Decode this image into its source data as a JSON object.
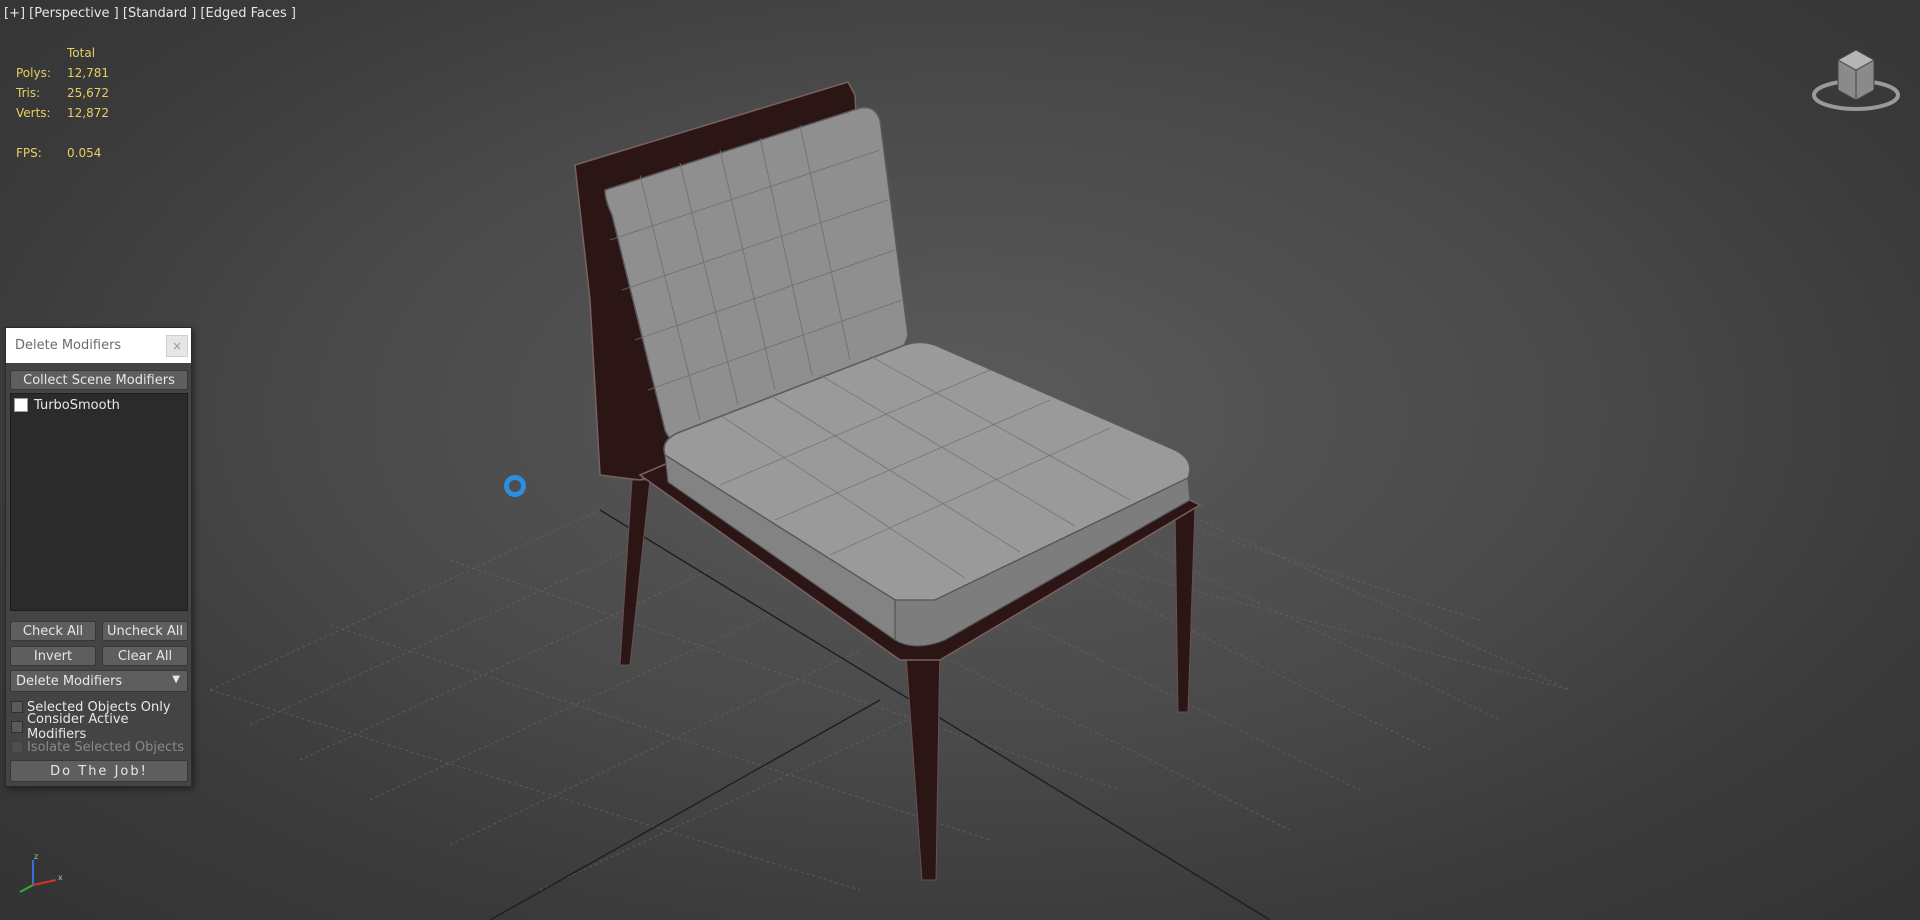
{
  "viewport": {
    "label": "[+] [Perspective ] [Standard ] [Edged Faces ]"
  },
  "stats": {
    "header": "Total",
    "polys_label": "Polys:",
    "polys_value": "12,781",
    "tris_label": "Tris:",
    "tris_value": "25,672",
    "verts_label": "Verts:",
    "verts_value": "12,872",
    "fps_label": "FPS:",
    "fps_value": "0.054"
  },
  "dialog": {
    "title": "Delete Modifiers",
    "close": "×",
    "collect_button": "Collect Scene Modifiers",
    "modifiers": [
      {
        "label": "TurboSmooth",
        "checked": false
      }
    ],
    "check_all": "Check All",
    "uncheck_all": "Uncheck All",
    "invert": "Invert",
    "clear_all": "Clear All",
    "mode_select": "Delete Modifiers",
    "options": [
      {
        "label": "Selected Objects Only",
        "checked": false,
        "enabled": true
      },
      {
        "label": "Consider Active Modifiers",
        "checked": false,
        "enabled": true
      },
      {
        "label": "Isolate Selected Objects",
        "checked": false,
        "enabled": false
      }
    ],
    "do_button": "Do The Job!"
  },
  "icons": {
    "viewcube": "viewcube-icon",
    "axis": "axis-gizmo-icon",
    "cursor": "loading-ring-icon"
  },
  "colors": {
    "stats_text": "#e6d060",
    "cursor_ring": "#2a8fe0",
    "chair_frame": "#2c1515",
    "cushion": "#8f8f8f"
  }
}
